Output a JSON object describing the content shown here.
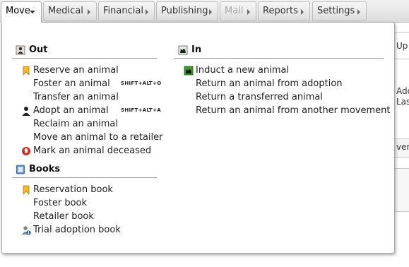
{
  "menubar": {
    "menus": [
      {
        "label": "Move",
        "state": "active",
        "arrow": "down"
      },
      {
        "label": "Medical",
        "state": "normal",
        "arrow": "right"
      },
      {
        "label": "Financial",
        "state": "normal",
        "arrow": "right"
      },
      {
        "label": "Publishing",
        "state": "normal",
        "arrow": "right"
      },
      {
        "label": "Mail",
        "state": "disabled",
        "arrow": "right"
      },
      {
        "label": "Reports",
        "state": "normal",
        "arrow": "right"
      },
      {
        "label": "Settings",
        "state": "normal",
        "arrow": "right"
      }
    ]
  },
  "background": {
    "fragments": [
      "Up",
      "Ado",
      "Las",
      "ven"
    ]
  },
  "dropdown": {
    "out": {
      "heading": "Out",
      "heading_icon": "person-out-icon",
      "items": [
        {
          "label": "Reserve an animal",
          "icon": "reserve-ribbon-icon",
          "shortcut": ""
        },
        {
          "label": "Foster an animal",
          "icon": "",
          "shortcut": "SHIFT+ALT+O"
        },
        {
          "label": "Transfer an animal",
          "icon": "",
          "shortcut": ""
        },
        {
          "label": "Adopt an animal",
          "icon": "person-icon",
          "shortcut": "SHIFT+ALT+A"
        },
        {
          "label": "Reclaim an animal",
          "icon": "",
          "shortcut": ""
        },
        {
          "label": "Move an animal to a retailer",
          "icon": "",
          "shortcut": ""
        },
        {
          "label": "Mark an animal deceased",
          "icon": "deceased-icon",
          "shortcut": ""
        }
      ]
    },
    "books": {
      "heading": "Books",
      "heading_icon": "book-icon",
      "items": [
        {
          "label": "Reservation book",
          "icon": "reserve-ribbon-icon"
        },
        {
          "label": "Foster book",
          "icon": ""
        },
        {
          "label": "Retailer book",
          "icon": ""
        },
        {
          "label": "Trial adoption book",
          "icon": "trial-adoption-icon"
        }
      ]
    },
    "in": {
      "heading": "In",
      "heading_icon": "animal-in-icon",
      "items": [
        {
          "label": "Induct a new animal",
          "icon": "induct-animal-icon"
        },
        {
          "label": "Return an animal from adoption",
          "icon": ""
        },
        {
          "label": "Return a transferred animal",
          "icon": ""
        },
        {
          "label": "Return an animal from another movement",
          "icon": ""
        }
      ]
    }
  }
}
